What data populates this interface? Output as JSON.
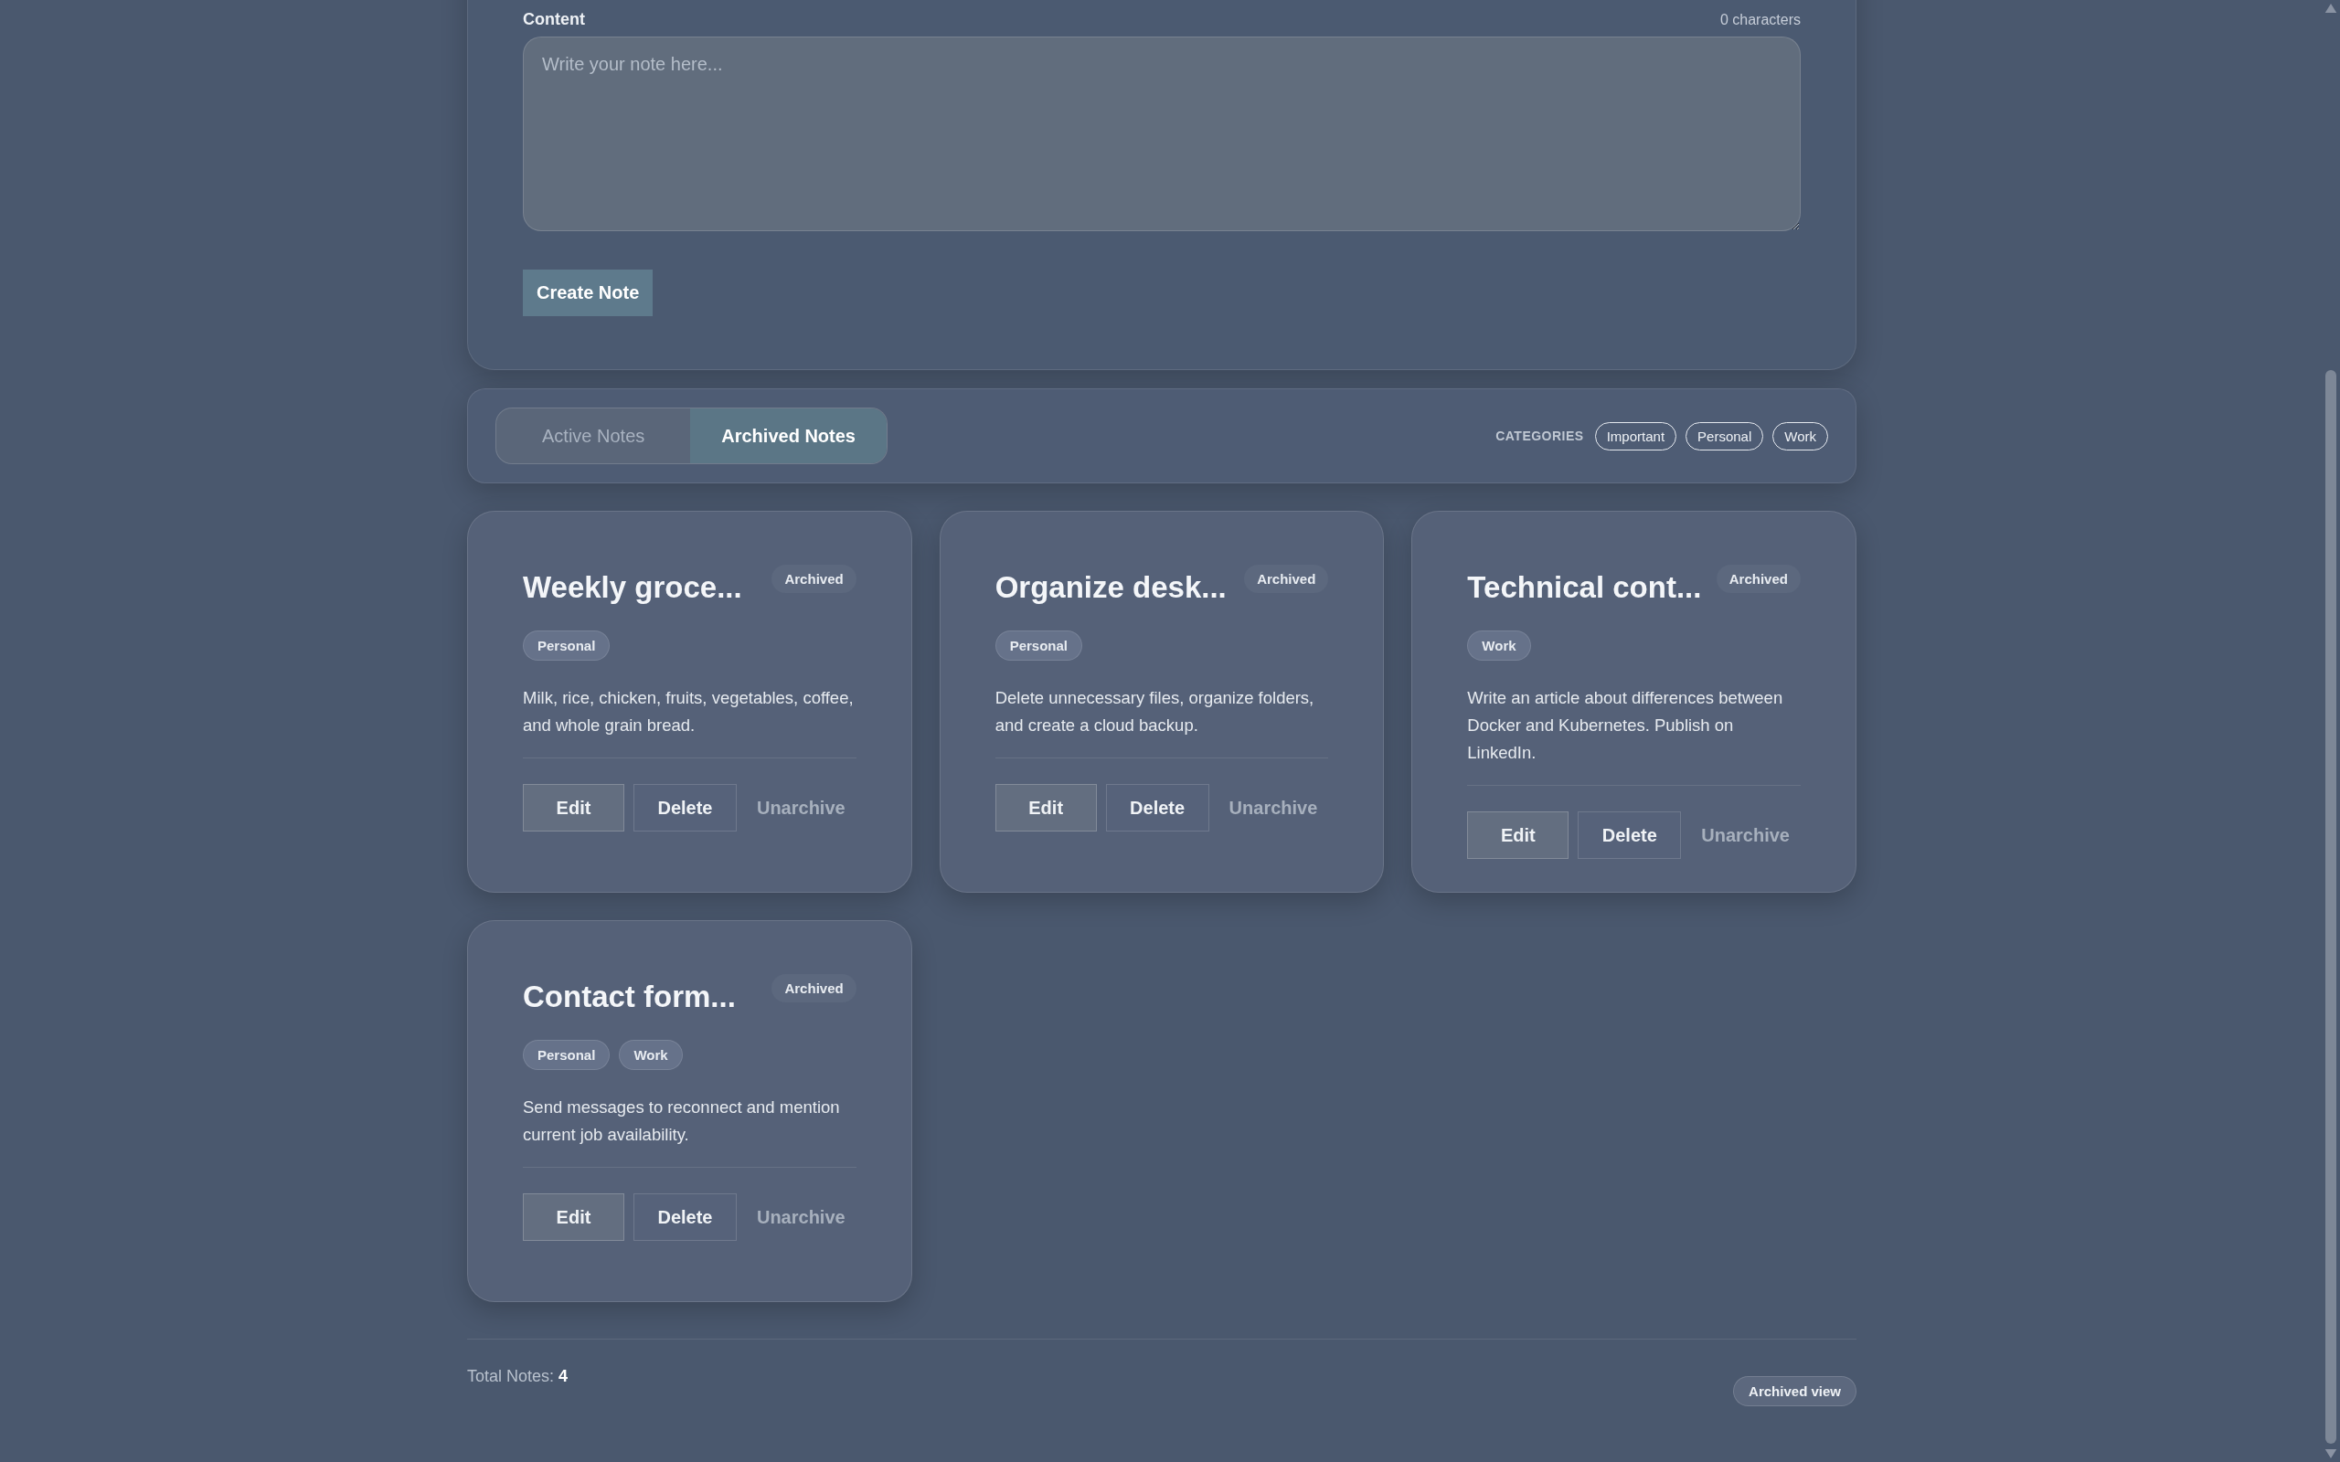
{
  "form": {
    "content_label": "Content",
    "char_count": "0 characters",
    "content": {
      "placeholder": "Write your note here..."
    },
    "submit": "Create Note"
  },
  "view_tabs": [
    {
      "label": "Active Notes",
      "selected": false
    },
    {
      "label": "Archived Notes",
      "selected": true
    }
  ],
  "categories": {
    "label": "CATEGORIES",
    "items": [
      "Important",
      "Personal",
      "Work"
    ]
  },
  "notes": [
    {
      "title": "Weekly groce...",
      "badge": "Archived",
      "tags": [
        "Personal"
      ],
      "body": "Milk, rice, chicken, fruits, vegetables, coffee, and whole grain bread.",
      "actions": [
        "Edit",
        "Delete",
        "Unarchive"
      ]
    },
    {
      "title": "Organize desk...",
      "badge": "Archived",
      "tags": [
        "Personal"
      ],
      "body": "Delete unnecessary files, organize folders, and create a cloud backup.",
      "actions": [
        "Edit",
        "Delete",
        "Unarchive"
      ]
    },
    {
      "title": "Technical cont...",
      "badge": "Archived",
      "tags": [
        "Work"
      ],
      "body": "Write an article about differences between Docker and Kubernetes. Publish on LinkedIn.",
      "actions": [
        "Edit",
        "Delete",
        "Unarchive"
      ]
    },
    {
      "title": "Contact form...",
      "badge": "Archived",
      "tags": [
        "Personal",
        "Work"
      ],
      "body": "Send messages to reconnect and mention current job availability.",
      "actions": [
        "Edit",
        "Delete",
        "Unarchive"
      ]
    }
  ],
  "footer": {
    "total": "Total Notes: **4**",
    "view_badge": "Archived view"
  }
}
